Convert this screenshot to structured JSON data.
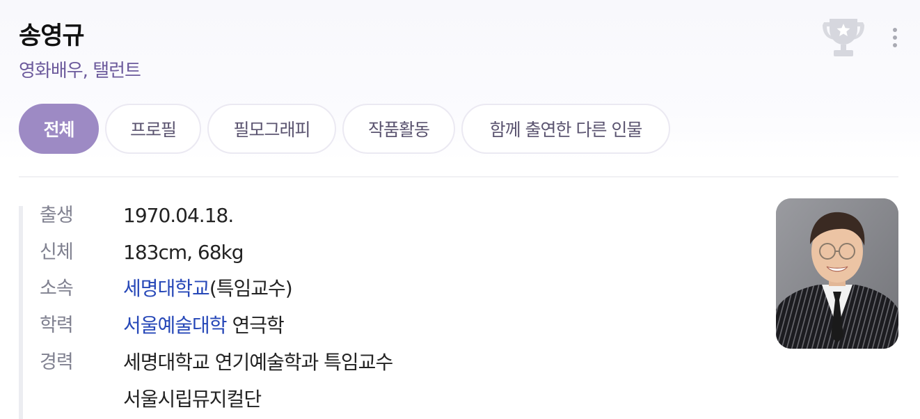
{
  "header": {
    "name": "송영규",
    "subtitle": "영화배우, 탤런트"
  },
  "icons": {
    "trophy": "trophy-icon",
    "more": "more-vertical-icon"
  },
  "tabs": [
    {
      "label": "전체",
      "active": true
    },
    {
      "label": "프로필",
      "active": false
    },
    {
      "label": "필모그래피",
      "active": false
    },
    {
      "label": "작품활동",
      "active": false
    },
    {
      "label": "함께 출연한 다른 인물",
      "active": false
    }
  ],
  "profile": {
    "birth": {
      "label": "출생",
      "value": "1970.04.18."
    },
    "body": {
      "label": "신체",
      "value": "183cm, 68kg"
    },
    "affiliation": {
      "label": "소속",
      "link": "세명대학교",
      "suffix": "(특임교수)"
    },
    "education": {
      "label": "학력",
      "link": "서울예술대학",
      "suffix": " 연극학"
    },
    "career": {
      "label": "경력",
      "items": [
        "세명대학교 연기예술학과 특임교수",
        "서울시립뮤지컬단"
      ]
    }
  },
  "colors": {
    "accent": "#9d8ac4",
    "subtitle": "#6c5a9c",
    "link": "#2748b8"
  }
}
